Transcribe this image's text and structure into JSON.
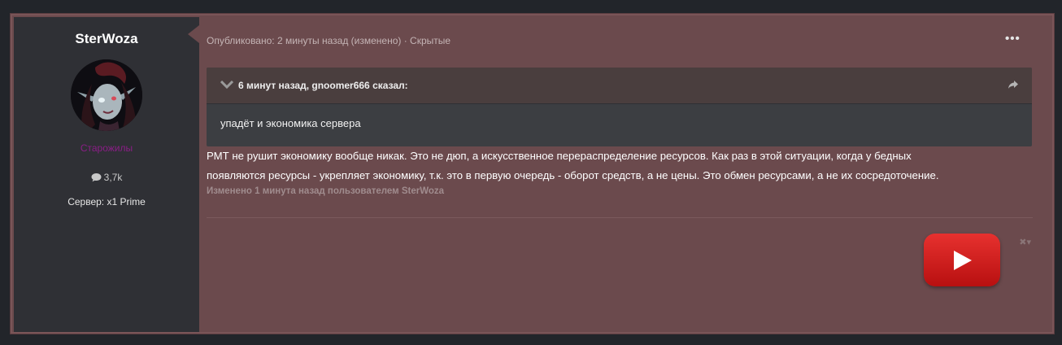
{
  "author": {
    "name": "SterWoza",
    "group": "Старожилы",
    "reputation": "3,7k",
    "server": "Сервер: x1 Prime"
  },
  "post": {
    "meta": "Опубликовано: 2 минуты назад (изменено) · Скрытые",
    "more_label": "•••",
    "quote": {
      "citation": "6 минут назад, gnoomer666 сказал:",
      "text": "упадёт и экономика сервера"
    },
    "content_line1": "РМТ не рушит экономику вообще никак. Это не дюп, а искусственное перераспределение ресурсов. Как раз в этой ситуации, когда у бедных",
    "content_line2": "появляются ресурсы - укрепляет экономику, т.к. это в первую очередь - оборот средств, а не цены. Это обмен ресурсами, а не их сосредоточение.",
    "edited": "Изменено 1 минута назад пользователем SterWoza"
  },
  "colors": {
    "post_bg": "#6b4a4d",
    "author_panel": "#2f3035",
    "group_color": "#8a1e86",
    "youtube_red": "#e62117"
  },
  "icons": [
    "comment-icon",
    "chevron-down-icon",
    "share-icon",
    "close-icon",
    "caret-down-icon",
    "youtube-play-icon"
  ]
}
